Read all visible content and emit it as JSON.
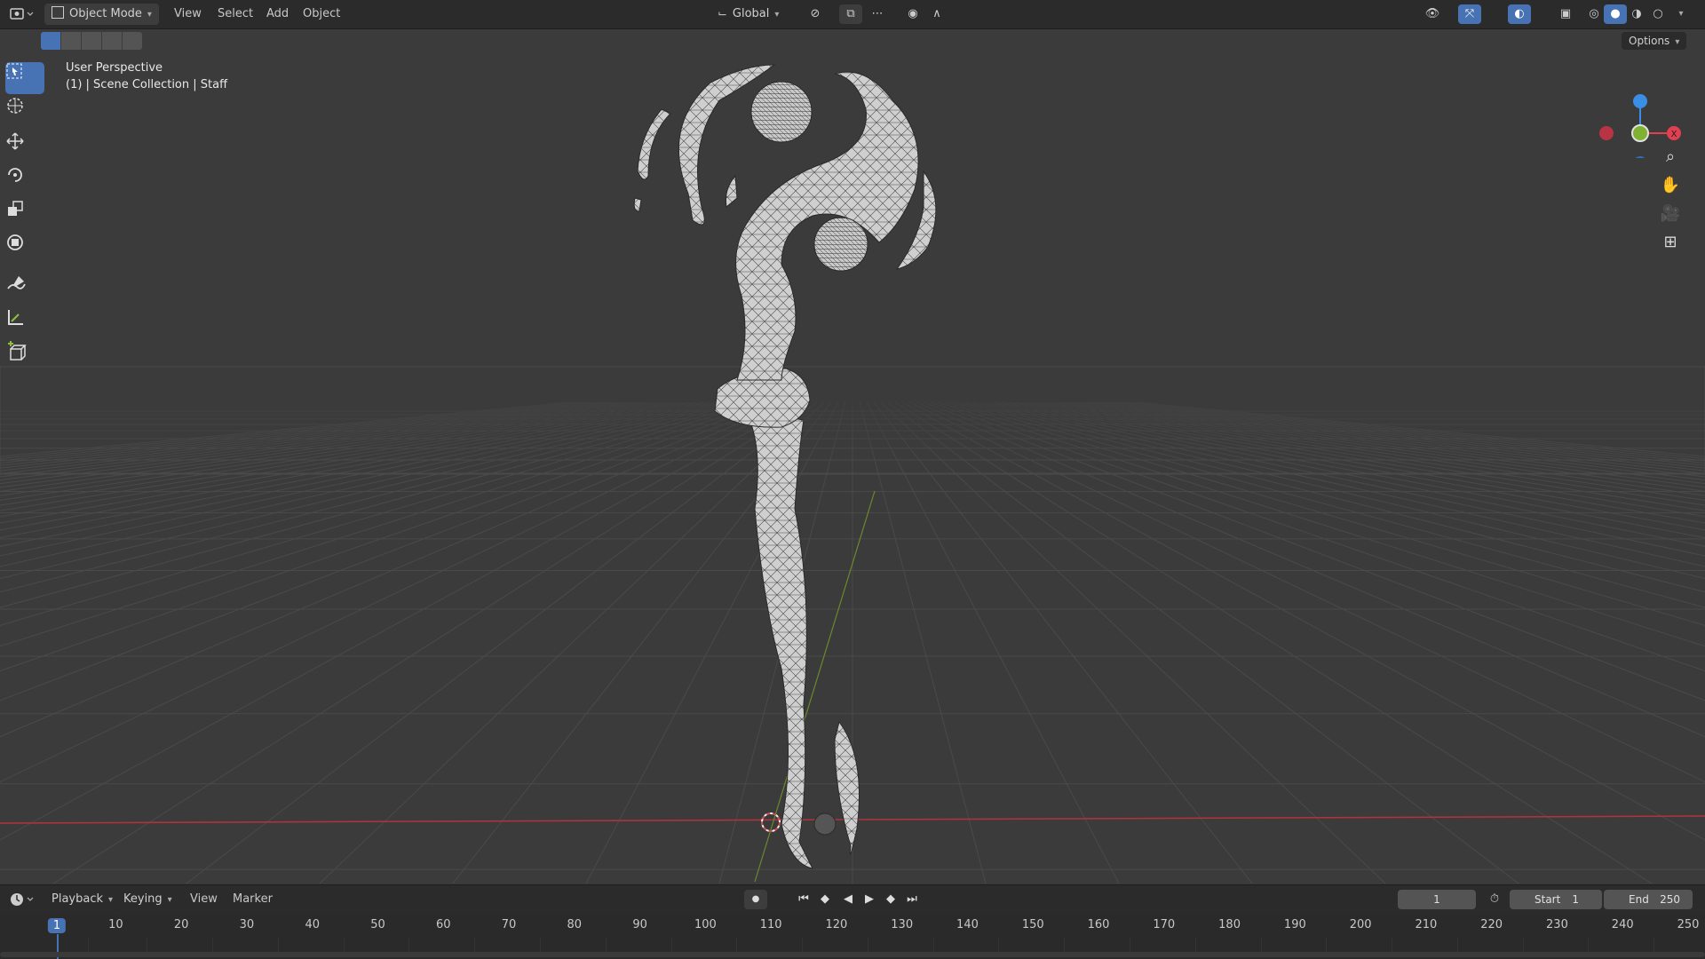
{
  "header": {
    "mode": "Object Mode",
    "menus": [
      "View",
      "Select",
      "Add",
      "Object"
    ],
    "transform_orientation": "Global",
    "options_label": "Options"
  },
  "viewport": {
    "perspective_label": "User Perspective",
    "collection_label": "(1) | Scene Collection | Staff"
  },
  "gizmo": {
    "axis_x": "X",
    "axis_y": "Y",
    "axis_z": "Z"
  },
  "toolbar": {
    "tools": [
      "select-box",
      "cursor",
      "move",
      "rotate",
      "scale",
      "transform",
      "annotate",
      "measure",
      "add-cube"
    ],
    "active": "select-box"
  },
  "timeline": {
    "menus": [
      "Playback",
      "Keying",
      "View",
      "Marker"
    ],
    "current_frame": "1",
    "start_label": "Start",
    "start_value": "1",
    "end_label": "End",
    "end_value": "250",
    "ticks": [
      "1",
      "10",
      "20",
      "30",
      "40",
      "50",
      "60",
      "70",
      "80",
      "90",
      "100",
      "110",
      "120",
      "130",
      "140",
      "150",
      "160",
      "170",
      "180",
      "190",
      "200",
      "210",
      "220",
      "230",
      "240",
      "250"
    ]
  },
  "colors": {
    "accent": "#4772b3",
    "axis_x": "#e0404f",
    "axis_y": "#7fb133",
    "axis_z": "#3a8ee6"
  }
}
